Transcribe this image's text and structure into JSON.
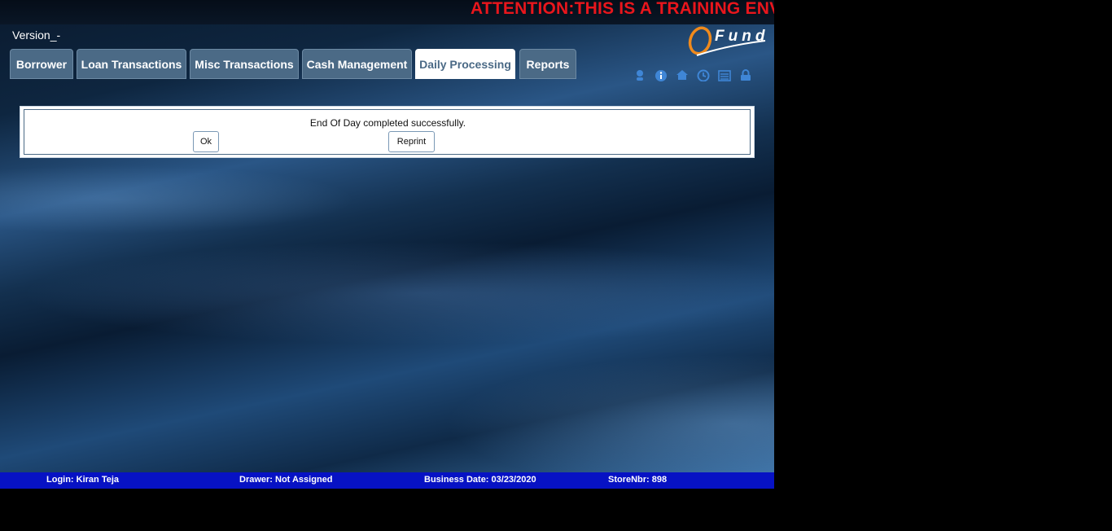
{
  "header": {
    "attention": "ATTENTION:THIS IS A TRAINING ENV",
    "version": "Version_-",
    "logo_text": "Fund"
  },
  "tabs": [
    {
      "label": "Borrower"
    },
    {
      "label": "Loan Transactions"
    },
    {
      "label": "Misc Transactions"
    },
    {
      "label": "Cash Management"
    },
    {
      "label": "Daily Processing",
      "active": true
    },
    {
      "label": "Reports"
    }
  ],
  "toolbar_icons": [
    "user-icon",
    "info-icon",
    "home-icon",
    "clock-icon",
    "list-icon",
    "lock-icon"
  ],
  "dialog": {
    "message": "End Of Day completed successfully.",
    "ok_label": "Ok",
    "reprint_label": "Reprint"
  },
  "status": {
    "login": "Login: Kiran Teja",
    "drawer": "Drawer: Not Assigned",
    "business_date": "Business Date: 03/23/2020",
    "store": "StoreNbr: 898"
  },
  "colors": {
    "attention": "#e8161c",
    "tab_bg": "#4b6a86",
    "status_bar": "#0712c4",
    "icon": "#3f86d6"
  }
}
